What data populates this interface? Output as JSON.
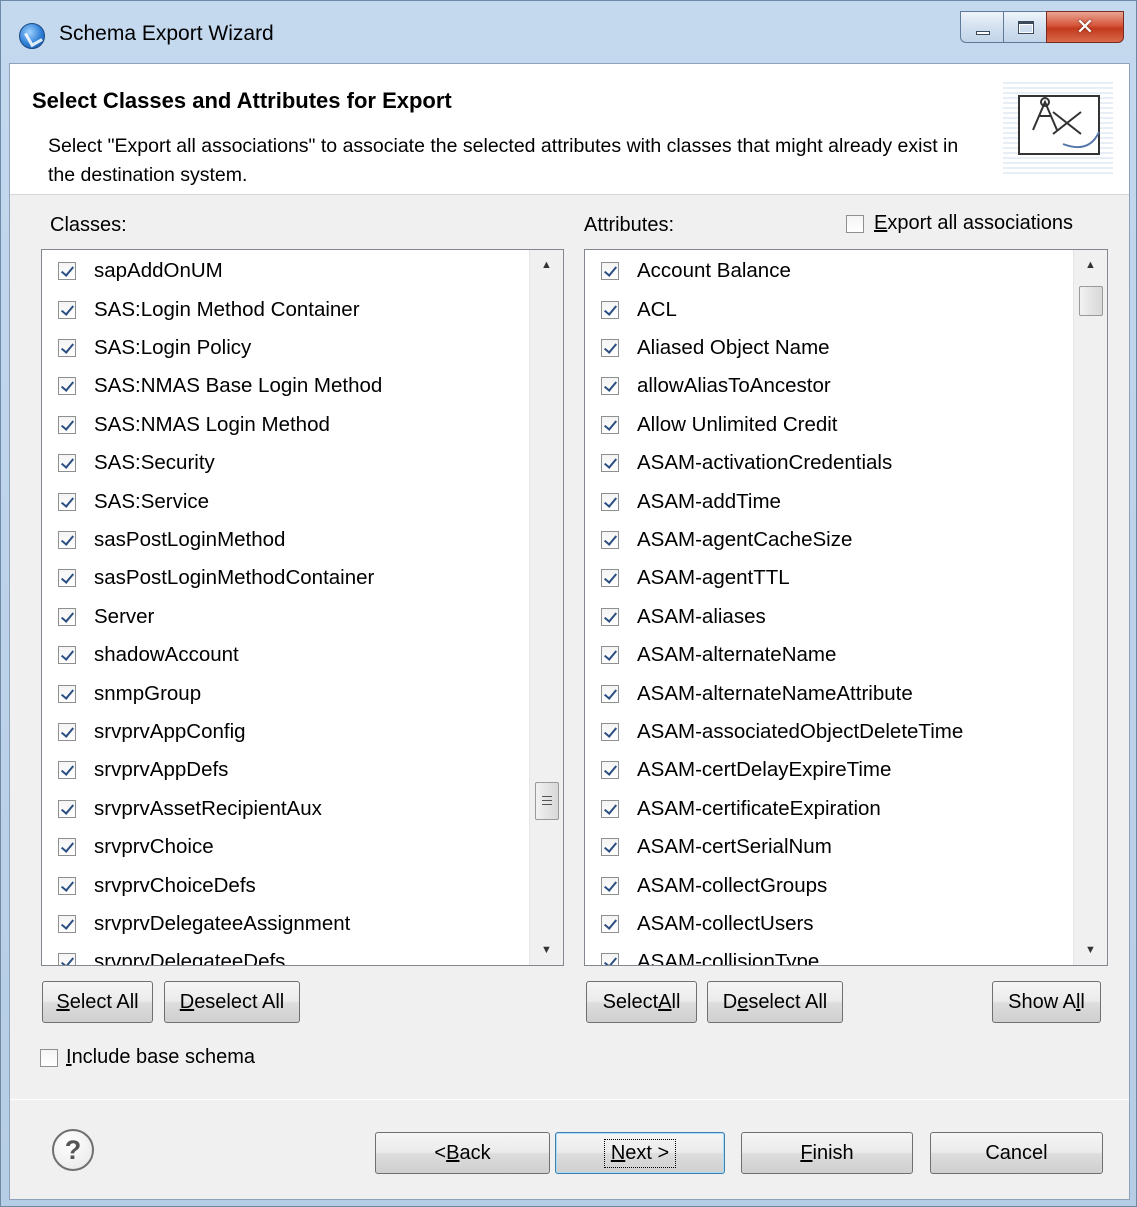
{
  "window": {
    "title": "Schema Export Wizard"
  },
  "header": {
    "title": "Select Classes and Attributes for Export",
    "description": "Select \"Export all associations\" to associate the selected attributes with classes that might already exist in the destination system."
  },
  "classes": {
    "label": "Classes:",
    "items": [
      {
        "label": "sapAddOnUM",
        "checked": true
      },
      {
        "label": "SAS:Login Method Container",
        "checked": true
      },
      {
        "label": "SAS:Login Policy",
        "checked": true
      },
      {
        "label": "SAS:NMAS Base Login Method",
        "checked": true
      },
      {
        "label": "SAS:NMAS Login Method",
        "checked": true
      },
      {
        "label": "SAS:Security",
        "checked": true
      },
      {
        "label": "SAS:Service",
        "checked": true
      },
      {
        "label": "sasPostLoginMethod",
        "checked": true
      },
      {
        "label": "sasPostLoginMethodContainer",
        "checked": true
      },
      {
        "label": "Server",
        "checked": true
      },
      {
        "label": "shadowAccount",
        "checked": true
      },
      {
        "label": "snmpGroup",
        "checked": true
      },
      {
        "label": "srvprvAppConfig",
        "checked": true
      },
      {
        "label": "srvprvAppDefs",
        "checked": true
      },
      {
        "label": "srvprvAssetRecipientAux",
        "checked": true
      },
      {
        "label": "srvprvChoice",
        "checked": true
      },
      {
        "label": "srvprvChoiceDefs",
        "checked": true
      },
      {
        "label": "srvprvDelegateeAssignment",
        "checked": true
      },
      {
        "label": "srvprvDelegateeDefs",
        "checked": true
      }
    ],
    "select_all": "Select All",
    "deselect_all": "Deselect All"
  },
  "attributes": {
    "label": "Attributes:",
    "export_all_associations": {
      "label": "Export all associations",
      "checked": false
    },
    "items": [
      {
        "label": "Account Balance",
        "checked": true
      },
      {
        "label": "ACL",
        "checked": true
      },
      {
        "label": "Aliased Object Name",
        "checked": true
      },
      {
        "label": "allowAliasToAncestor",
        "checked": true
      },
      {
        "label": "Allow Unlimited Credit",
        "checked": true
      },
      {
        "label": "ASAM-activationCredentials",
        "checked": true
      },
      {
        "label": "ASAM-addTime",
        "checked": true
      },
      {
        "label": "ASAM-agentCacheSize",
        "checked": true
      },
      {
        "label": "ASAM-agentTTL",
        "checked": true
      },
      {
        "label": "ASAM-aliases",
        "checked": true
      },
      {
        "label": "ASAM-alternateName",
        "checked": true
      },
      {
        "label": "ASAM-alternateNameAttribute",
        "checked": true
      },
      {
        "label": "ASAM-associatedObjectDeleteTime",
        "checked": true
      },
      {
        "label": "ASAM-certDelayExpireTime",
        "checked": true
      },
      {
        "label": "ASAM-certificateExpiration",
        "checked": true
      },
      {
        "label": "ASAM-certSerialNum",
        "checked": true
      },
      {
        "label": "ASAM-collectGroups",
        "checked": true
      },
      {
        "label": "ASAM-collectUsers",
        "checked": true
      },
      {
        "label": "ASAM-collisionType",
        "checked": true
      }
    ],
    "select_all": "Select All",
    "deselect_all": "Deselect All",
    "show_all": "Show All"
  },
  "include_base_schema": {
    "label": "Include base schema",
    "checked": false
  },
  "footer": {
    "back": "< Back",
    "next": "Next >",
    "finish": "Finish",
    "cancel": "Cancel",
    "help": "?"
  }
}
